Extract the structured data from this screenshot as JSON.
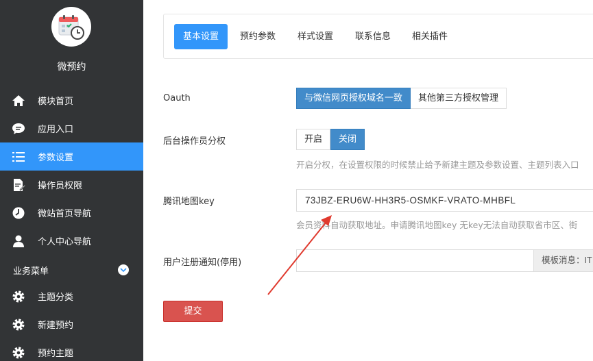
{
  "sidebar": {
    "app_name": "微预约",
    "items": [
      {
        "label": "模块首页",
        "icon": "home-icon"
      },
      {
        "label": "应用入口",
        "icon": "chat-bubble-icon"
      },
      {
        "label": "参数设置",
        "icon": "list-icon",
        "active": true
      },
      {
        "label": "操作员权限",
        "icon": "document-edit-icon"
      },
      {
        "label": "微站首页导航",
        "icon": "clock-icon"
      },
      {
        "label": "个人中心导航",
        "icon": "user-icon"
      }
    ],
    "section_title": "业务菜单",
    "section_items": [
      {
        "label": "主题分类",
        "icon": "gear-icon"
      },
      {
        "label": "新建预约",
        "icon": "gear-icon"
      },
      {
        "label": "预约主题",
        "icon": "gear-icon"
      }
    ]
  },
  "tabs": [
    "基本设置",
    "预约参数",
    "样式设置",
    "联系信息",
    "相关插件"
  ],
  "form": {
    "oauth_label": "Oauth",
    "oauth_options": [
      "与微信网页授权域名一致",
      "其他第三方授权管理"
    ],
    "operator_label": "后台操作员分权",
    "operator_options": [
      "开启",
      "关闭"
    ],
    "operator_help": "开启分权，在设置权限的时候禁止给予新建主题及参数设置、主题列表入口",
    "map_key_label": "腾讯地图key",
    "map_key_value": "73JBZ-ERU6W-HH3R5-OSMKF-VRATO-MHBFL",
    "map_key_help": "会员资料自动获取地址。申请腾讯地图key 无key无法自动获取省市区、街",
    "notify_label": "用户注册通知(停用)",
    "notify_value": "",
    "notify_addon": "模板消息：IT",
    "submit_label": "提交"
  },
  "colors": {
    "sidebar_bg": "#323436",
    "accent": "#3296fa",
    "toggle_on": "#428bca",
    "submit": "#d9534f",
    "arrow": "#e03a2e"
  }
}
